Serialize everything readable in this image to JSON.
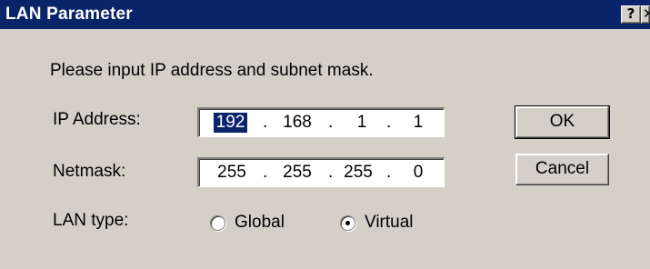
{
  "window": {
    "title": "LAN Parameter",
    "help_glyph": "?",
    "close_glyph": "✕"
  },
  "instructions": "Please input IP address and subnet mask.",
  "ip_address": {
    "label": "IP Address:",
    "octets": [
      "192",
      "168",
      "1",
      "1"
    ],
    "selected_octet": 0
  },
  "netmask": {
    "label": "Netmask:",
    "octets": [
      "255",
      "255",
      "255",
      "0"
    ]
  },
  "lan_type": {
    "label": "LAN type:",
    "options": [
      {
        "label": "Global",
        "selected": false
      },
      {
        "label": "Virtual",
        "selected": true
      }
    ]
  },
  "buttons": {
    "ok": "OK",
    "cancel": "Cancel"
  },
  "separator": ".",
  "colors": {
    "titlebar": "#0a246a",
    "face": "#d4d0c8"
  }
}
